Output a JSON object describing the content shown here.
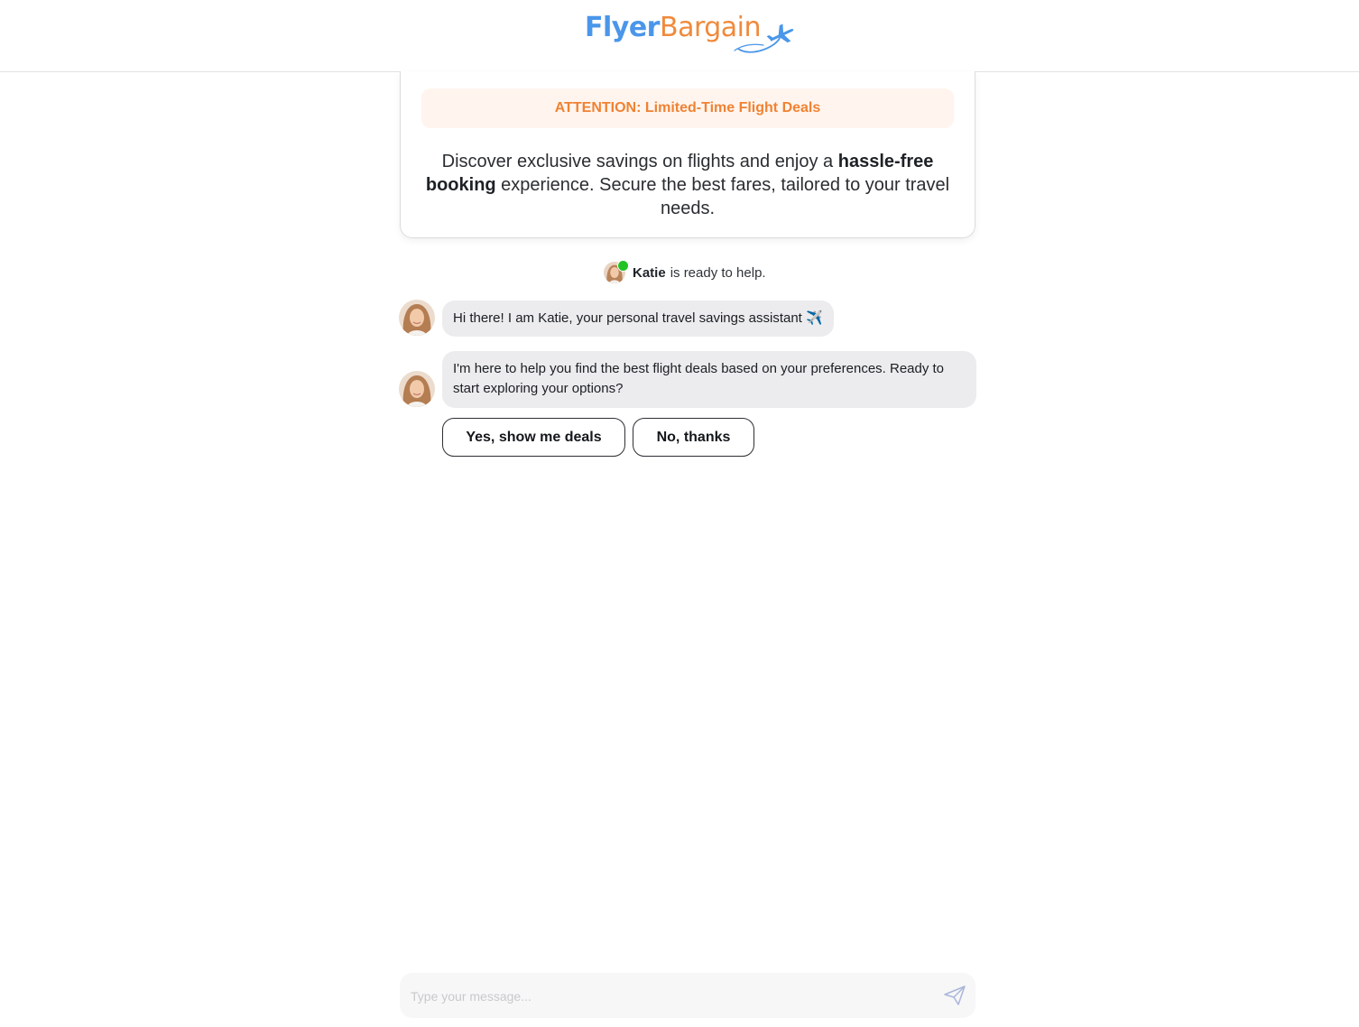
{
  "header": {
    "logo_part1": "Flyer",
    "logo_part2": "Bargain",
    "brand_blue": "#4a96ea",
    "brand_orange": "#f08a3c"
  },
  "promo": {
    "attention": "ATTENTION: Limited-Time Flight Deals",
    "text_before": "Discover exclusive savings on flights and enjoy a ",
    "text_bold": "hassle-free booking",
    "text_after": " experience. Secure the best fares, tailored to your travel needs."
  },
  "status": {
    "name": "Katie",
    "text": "is ready to help.",
    "online_color": "#22c322"
  },
  "messages": [
    {
      "text": "Hi there! I am Katie, your personal travel savings assistant ✈️"
    },
    {
      "text": "I'm here to help you find the best flight deals based on your preferences. Ready to start exploring your options?"
    }
  ],
  "options": {
    "yes": "Yes, show me deals",
    "no": "No, thanks"
  },
  "composer": {
    "placeholder": "Type your message...",
    "send_icon": "paper-plane-icon"
  }
}
